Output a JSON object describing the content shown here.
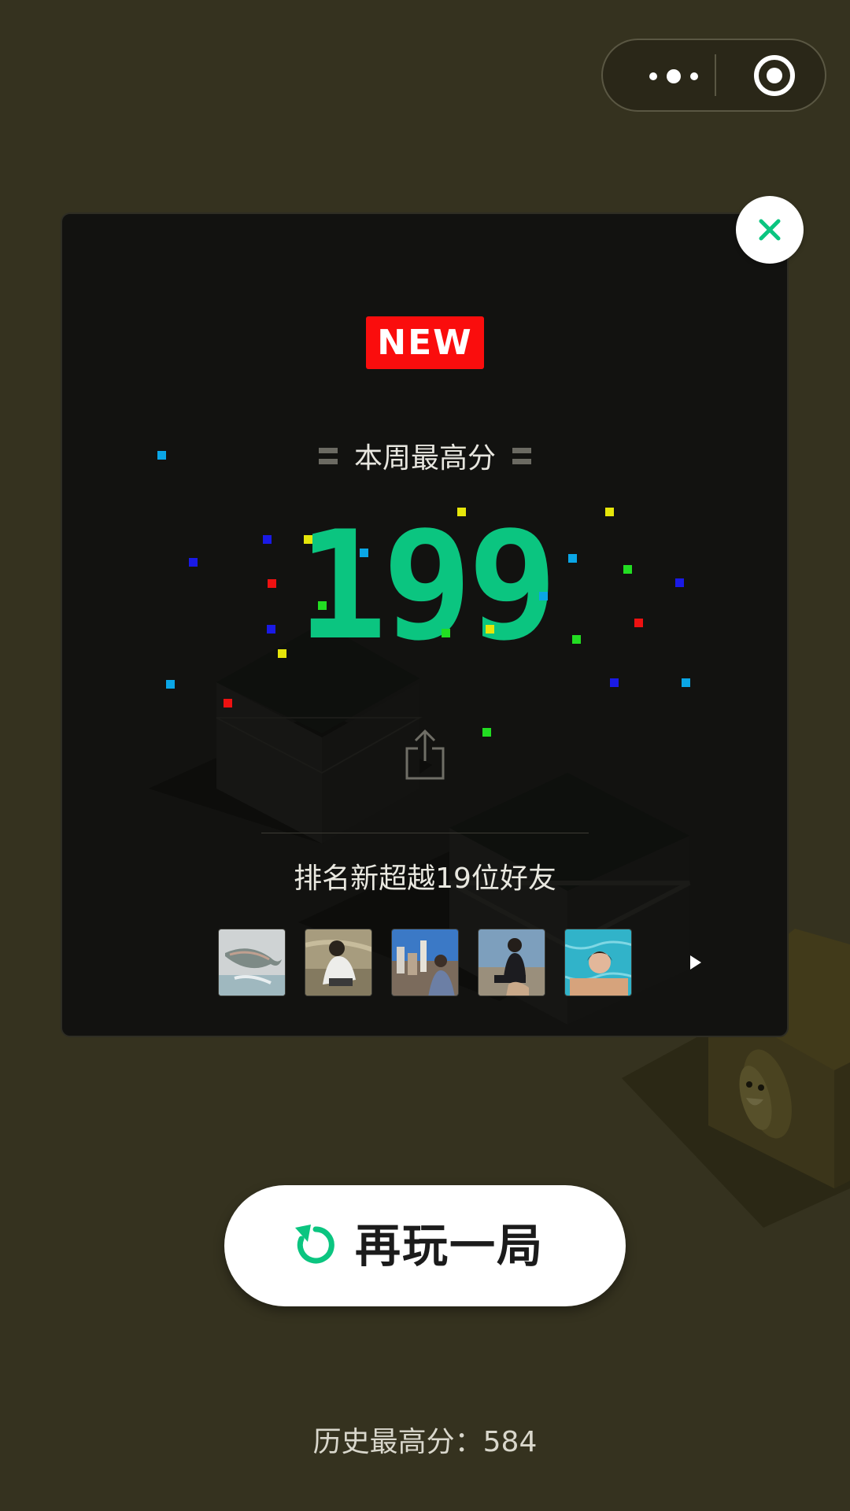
{
  "topbar": {
    "more_icon": "more-dots-icon",
    "close_icon": "target-circle-icon"
  },
  "card": {
    "badge": "NEW",
    "week_title": "本周最高分",
    "score": "199",
    "share_icon": "share-icon",
    "rank_text": "排名新超越19位好友",
    "friends": [
      {
        "name": "friend-avatar-1"
      },
      {
        "name": "friend-avatar-2"
      },
      {
        "name": "friend-avatar-3"
      },
      {
        "name": "friend-avatar-4"
      },
      {
        "name": "friend-avatar-5"
      }
    ],
    "close_icon": "close-x-icon",
    "more_arrow_icon": "play-arrow-icon"
  },
  "replay": {
    "label": "再玩一局",
    "icon": "replay-icon"
  },
  "history": {
    "text": "历史最高分：584"
  },
  "colors": {
    "background": "#35321f",
    "card": "#121210",
    "accent_green": "#0bc580",
    "badge_red": "#fa0d0d",
    "white": "#ffffff"
  }
}
